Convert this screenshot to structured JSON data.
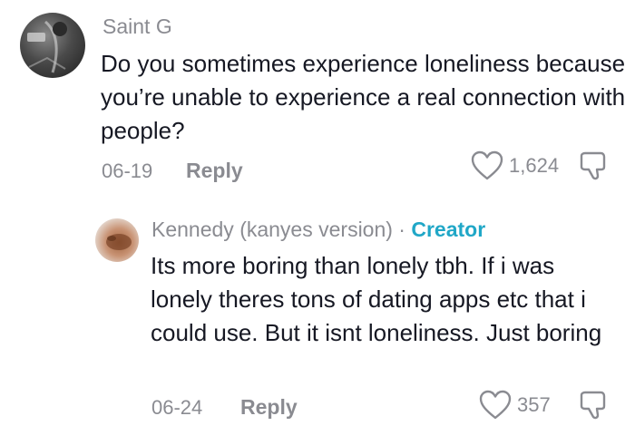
{
  "comment": {
    "username": "Saint G",
    "text": "Do you sometimes experience loneliness because you’re unable to experience a real connection with people?",
    "date": "06-19",
    "reply_label": "Reply",
    "likes": "1,624"
  },
  "reply": {
    "username": "Kennedy (kanyes version)",
    "separator": " · ",
    "badge": "Creator",
    "text": "Its more boring than lonely tbh. If i was lonely theres tons of dating apps etc that i could use. But it isnt loneliness. Just boring",
    "date": "06-24",
    "reply_label": "Reply",
    "likes": "357"
  },
  "colors": {
    "meta_gray": "#8a8b91",
    "text": "#161823",
    "creator_badge": "#20a7c7"
  },
  "icons": [
    "heart-icon",
    "dislike-icon"
  ]
}
